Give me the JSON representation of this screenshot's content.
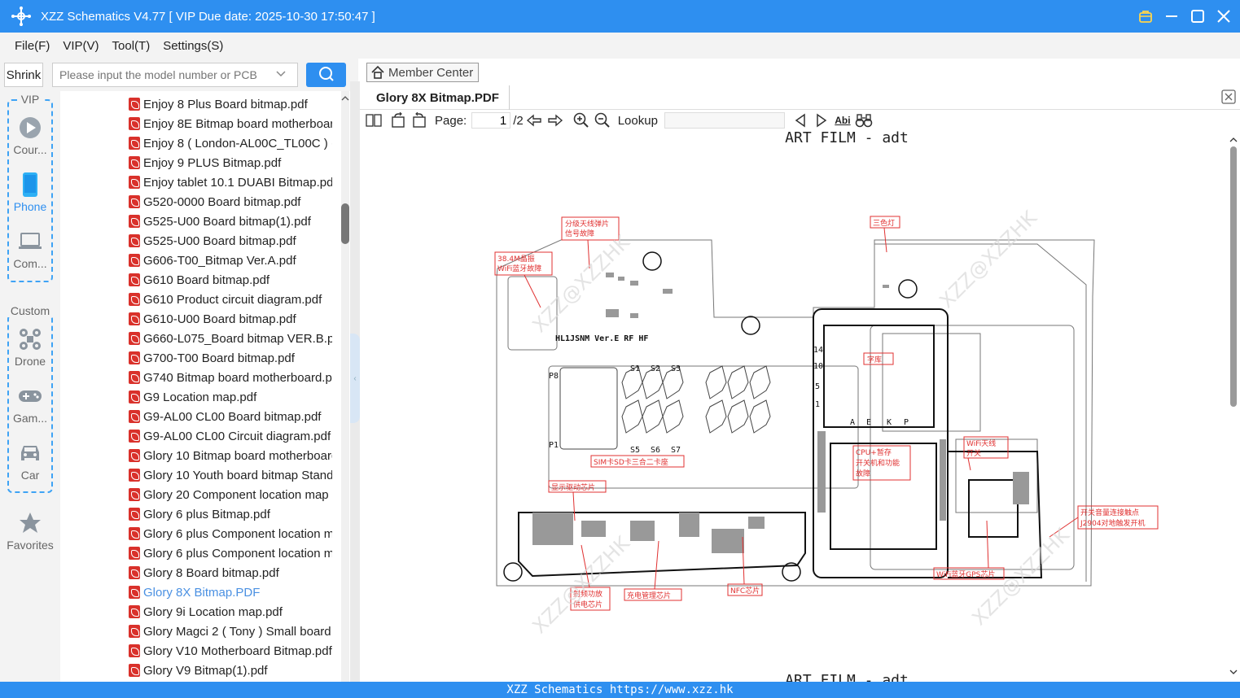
{
  "app": {
    "title": "XZZ Schematics V4.77 [ VIP Due date: 2025-10-30 17:50:47 ]"
  },
  "menu": {
    "file": "File(F)",
    "vip": "VIP(V)",
    "tool": "Tool(T)",
    "settings": "Settings(S)"
  },
  "search": {
    "shrink_label": "Shrink",
    "placeholder": "Please input the model number or PCB"
  },
  "sidebar": {
    "vip_group_label": "VIP",
    "custom_group_label": "Custom",
    "items": [
      {
        "label": "Cour...",
        "icon": "play-circle-icon"
      },
      {
        "label": "Phone",
        "icon": "phone-icon",
        "active": true
      },
      {
        "label": "Com...",
        "icon": "laptop-icon"
      },
      {
        "label": "Drone",
        "icon": "drone-icon"
      },
      {
        "label": "Gam...",
        "icon": "gamepad-icon"
      },
      {
        "label": "Car",
        "icon": "car-icon"
      },
      {
        "label": "Favorites",
        "icon": "star-icon"
      }
    ],
    "accent": "#3ea3f5"
  },
  "files": [
    {
      "name": "Enjoy 8 Plus Board bitmap.pdf"
    },
    {
      "name": "Enjoy 8E Bitmap board motherboard"
    },
    {
      "name": "Enjoy 8 ( London-AL00C_TL00C ) ("
    },
    {
      "name": "Enjoy 9 PLUS Bitmap.pdf"
    },
    {
      "name": "Enjoy tablet 10.1 DUABI Bitmap.pdf"
    },
    {
      "name": "G520-0000 Board bitmap.pdf"
    },
    {
      "name": "G525-U00 Board bitmap(1).pdf"
    },
    {
      "name": "G525-U00 Board bitmap.pdf"
    },
    {
      "name": "G606-T00_Bitmap Ver.A.pdf"
    },
    {
      "name": "G610 Board bitmap.pdf"
    },
    {
      "name": "G610 Product circuit diagram.pdf"
    },
    {
      "name": "G610-U00 Board bitmap.pdf"
    },
    {
      "name": "G660-L075_Board bitmap VER.B.pdf"
    },
    {
      "name": "G700-T00 Board bitmap.pdf"
    },
    {
      "name": "G740 Bitmap board motherboard.pdf"
    },
    {
      "name": "G9 Location map.pdf"
    },
    {
      "name": "G9-AL00 CL00 Board bitmap.pdf"
    },
    {
      "name": "G9-AL00 CL00 Circuit diagram.pdf"
    },
    {
      "name": "Glory 10 Bitmap board motherboard"
    },
    {
      "name": "Glory 10 Youth board bitmap Standard"
    },
    {
      "name": "Glory 20 Component location map"
    },
    {
      "name": "Glory 6 plus Bitmap.pdf"
    },
    {
      "name": "Glory 6 plus Component location map"
    },
    {
      "name": "Glory 6 plus Component location map"
    },
    {
      "name": "Glory 8 Board bitmap.pdf"
    },
    {
      "name": "Glory 8X Bitmap.PDF",
      "active": true
    },
    {
      "name": "Glory 9i Location map.pdf"
    },
    {
      "name": "Glory Magci 2 ( Tony ) Small board"
    },
    {
      "name": "Glory V10 Motherboard Bitmap.pdf"
    },
    {
      "name": "Glory V9 Bitmap(1).pdf"
    }
  ],
  "viewer": {
    "member_center": "Member Center",
    "tab_title": "Glory 8X Bitmap.PDF",
    "page_label": "Page:",
    "page_current": "1",
    "page_total": "/2",
    "lookup_label": "Lookup",
    "abi_label": "Abi"
  },
  "schematic": {
    "header": "ART FILM - adt",
    "header_next": "ART FILM - adt",
    "board_name": "HL1JSNM Ver.E RF HF",
    "watermark": "XZZ@XZZHK",
    "labels": {
      "antenna_shrapnel": "分级天线弹片",
      "antenna_shrapnel_2": "信号故障",
      "crystal": "38.4M晶振",
      "crystal_2": "WiFi蓝牙故障",
      "tricolor": "三色灯",
      "font_lib": "字库",
      "cpu": "CPU+暂存",
      "cpu_2": "开关机和功能",
      "cpu_3": "故障",
      "wifi_antenna": "WiFi天线",
      "wifi_antenna_2": "开关",
      "sim": "SIM卡SD卡三合二卡座",
      "display_driver": "显示驱动芯片",
      "switch_vol": "开关音量连接触点",
      "switch_vol_2": "J2904对地触发开机",
      "rf_pa": "射频功放",
      "rf_pa_2": "供电芯片",
      "charge": "充电管理芯片",
      "nfc": "NFC芯片",
      "wifi_gps": "WiFi蓝牙GPS芯片"
    },
    "pins": [
      "14",
      "10",
      "5",
      "1",
      "A",
      "E",
      "K",
      "P",
      "P8",
      "P1",
      "S1",
      "S2",
      "S3",
      "S5",
      "S6",
      "S7"
    ]
  },
  "footer": {
    "text": "XZZ Schematics https://www.xzz.hk"
  },
  "colors": {
    "brand": "#2e8ff0",
    "annotation": "#e03030",
    "active_file": "#4a90e2"
  }
}
